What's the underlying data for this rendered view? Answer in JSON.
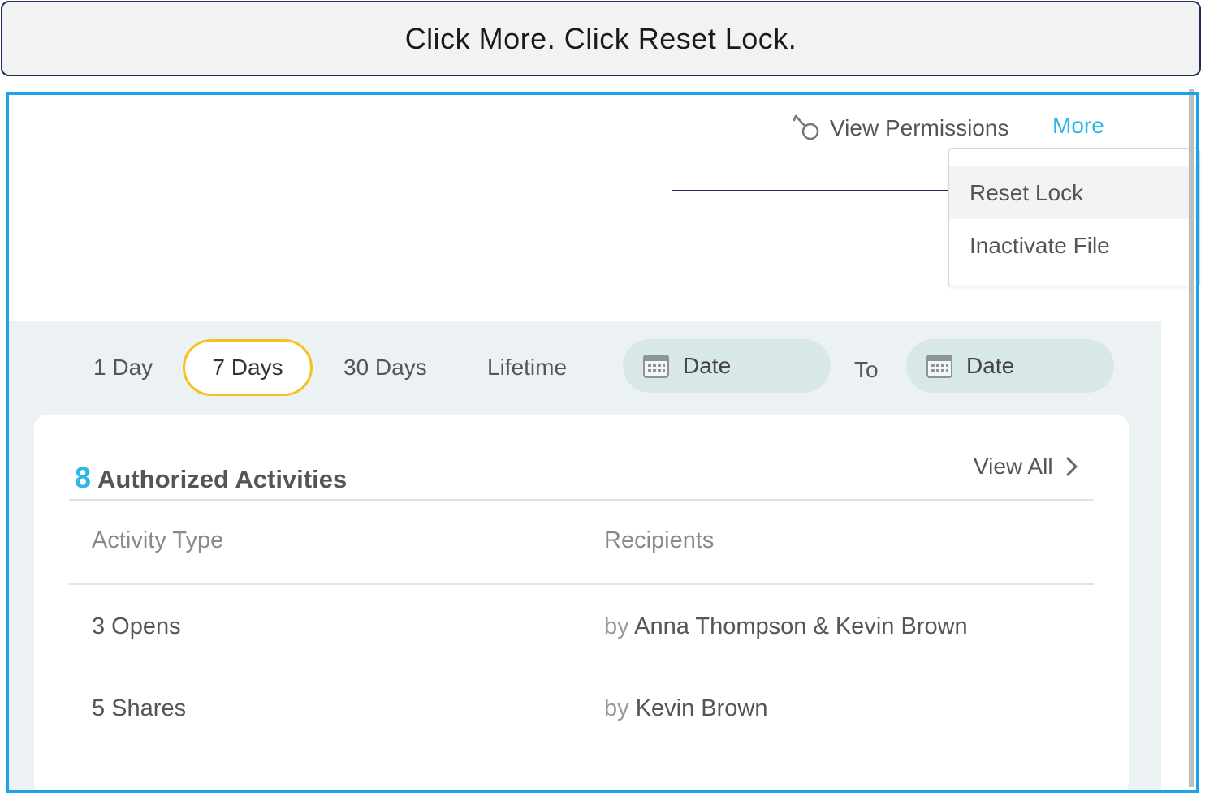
{
  "instruction": {
    "text": "Click More. Click Reset Lock."
  },
  "header": {
    "view_permissions_label": "View Permissions",
    "more_label": "More"
  },
  "more_menu": {
    "items": [
      {
        "label": "Reset Lock",
        "highlighted": true
      },
      {
        "label": "Inactivate File",
        "highlighted": false
      }
    ]
  },
  "filters": {
    "ranges": [
      "1 Day",
      "7 Days",
      "30 Days",
      "Lifetime"
    ],
    "selected_range": "7 Days",
    "start_date_placeholder": "Date",
    "to_label": "To",
    "end_date_placeholder": "Date"
  },
  "activities": {
    "count": "8",
    "title": "Authorized Activities",
    "view_all_label": "View All",
    "columns": [
      "Activity Type",
      "Recipients"
    ],
    "by_label": "by",
    "rows": [
      {
        "activity": "3 Opens",
        "recipients": "Anna Thompson & Kevin Brown"
      },
      {
        "activity": "5 Shares",
        "recipients": "Kevin Brown"
      }
    ]
  },
  "colors": {
    "accent_blue": "#2eb6e6",
    "selected_outline": "#f5c21b",
    "highlight_frame": "#1aa3e6",
    "callout_border": "#1b2f5c"
  },
  "icons": {
    "permissions": "key-icon",
    "date": "calendar-icon",
    "view_all": "chevron-right-icon"
  }
}
